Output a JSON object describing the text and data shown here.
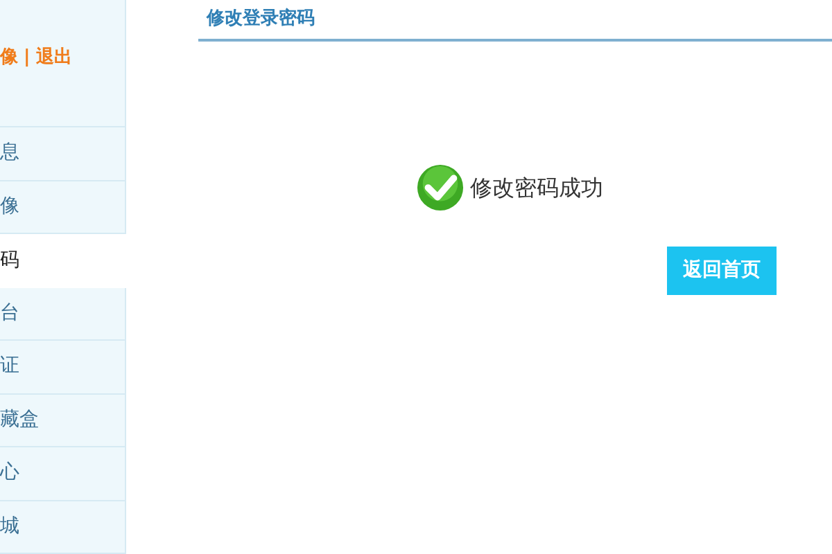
{
  "sidebar": {
    "user_links": [
      {
        "label": "像"
      },
      {
        "label": "|"
      },
      {
        "label": "退出"
      }
    ],
    "items": [
      {
        "label": "息",
        "selected": false
      },
      {
        "label": "像",
        "selected": false
      },
      {
        "label": "码",
        "selected": true
      },
      {
        "label": "台",
        "selected": false
      },
      {
        "label": "证",
        "selected": false
      },
      {
        "label": "藏盒",
        "selected": false
      },
      {
        "label": "心",
        "selected": false
      },
      {
        "label": "城",
        "selected": false
      }
    ]
  },
  "main": {
    "title": "修改登录密码",
    "message": "修改密码成功",
    "button": "返回首页"
  }
}
